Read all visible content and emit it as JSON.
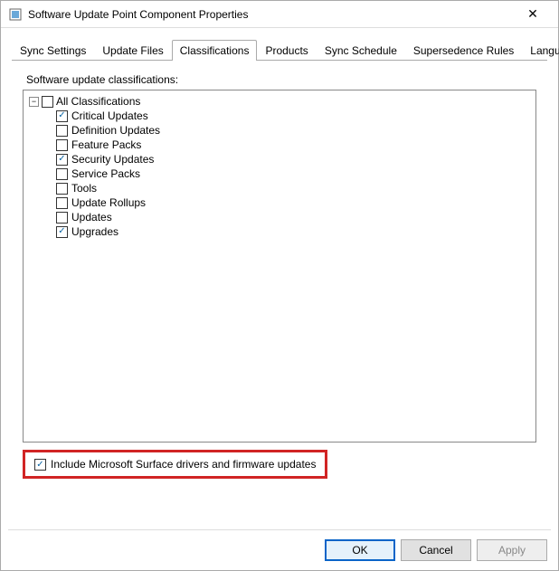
{
  "window": {
    "title": "Software Update Point Component Properties",
    "close_symbol": "✕"
  },
  "tabs": [
    {
      "label": "Sync Settings",
      "active": false
    },
    {
      "label": "Update Files",
      "active": false
    },
    {
      "label": "Classifications",
      "active": true
    },
    {
      "label": "Products",
      "active": false
    },
    {
      "label": "Sync Schedule",
      "active": false
    },
    {
      "label": "Supersedence Rules",
      "active": false
    },
    {
      "label": "Languages",
      "active": false
    }
  ],
  "section_label": "Software update classifications:",
  "tree": {
    "toggle_symbol": "−",
    "root_label": "All Classifications",
    "root_checked": false,
    "items": [
      {
        "label": "Critical Updates",
        "checked": true
      },
      {
        "label": "Definition Updates",
        "checked": false
      },
      {
        "label": "Feature Packs",
        "checked": false
      },
      {
        "label": "Security Updates",
        "checked": true
      },
      {
        "label": "Service Packs",
        "checked": false
      },
      {
        "label": "Tools",
        "checked": false
      },
      {
        "label": "Update Rollups",
        "checked": false
      },
      {
        "label": "Updates",
        "checked": false
      },
      {
        "label": "Upgrades",
        "checked": true
      }
    ]
  },
  "include_surface": {
    "label": "Include Microsoft Surface drivers and firmware updates",
    "checked": true
  },
  "buttons": {
    "ok": "OK",
    "cancel": "Cancel",
    "apply": "Apply"
  }
}
